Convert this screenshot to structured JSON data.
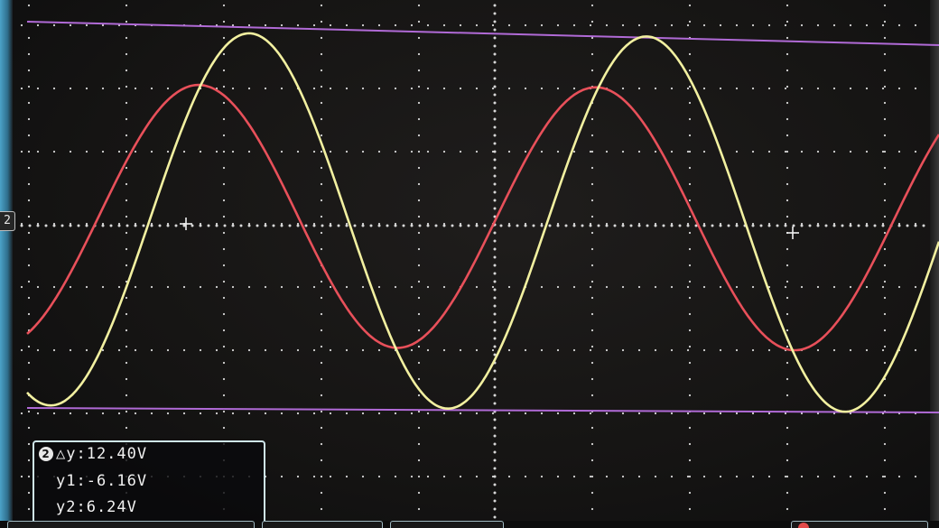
{
  "channel_marker": "2",
  "measurement": {
    "channel": "2",
    "delta_y": "△y:12.40V",
    "y1": "y1:-6.16V",
    "y2": "y2:6.24V"
  },
  "colors": {
    "grid": "#d8d8d8",
    "ch1_red": "#e8505a",
    "ch2_yellow": "#f2f0a0",
    "cursor_purple": "#b06ad6",
    "background": "#151413"
  },
  "icons": {
    "channel_marker": "channel-2-marker-icon",
    "trigger": "trigger-edge-icon"
  }
}
